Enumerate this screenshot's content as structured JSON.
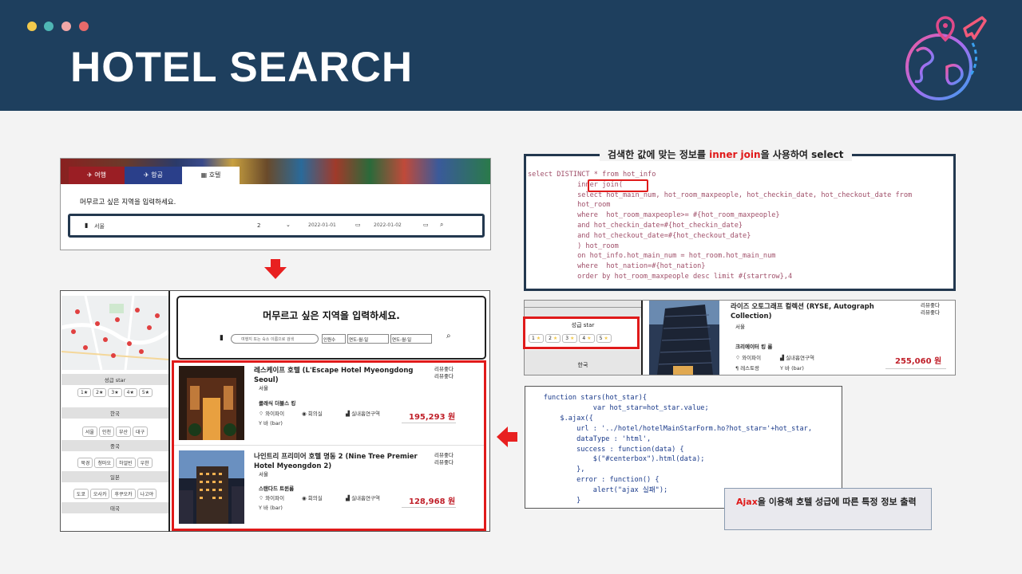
{
  "header": {
    "title": "HOTEL SEARCH",
    "dots": [
      "#f2c94c",
      "#4fb6b4",
      "#f2a7a7",
      "#e86a6a"
    ]
  },
  "search_top": {
    "tabs": [
      "여행",
      "항공",
      "호텔"
    ],
    "prompt": "머무르고 싶은 지역을 입력하세요.",
    "location": "서울",
    "guests": "2",
    "checkin": "2022-01-01",
    "checkout": "2022-01-02"
  },
  "result": {
    "prompt": "머무르고 싶은 지역을 입력하세요.",
    "search_placeholder": "여행지 또는 숙소 이름으로 검색",
    "guests": "인원수",
    "date1": "연도-월-일",
    "date2": "연도-월-일",
    "sidebar": {
      "star_label": "성급 star",
      "stars": [
        "1",
        "2",
        "3",
        "4",
        "5"
      ],
      "korea": "한국",
      "korea_cities": [
        "서울",
        "인천",
        "부산",
        "대구"
      ],
      "china": "중국",
      "china_cities": [
        "북경",
        "청마오",
        "하얼빈",
        "우한"
      ],
      "japan": "일본",
      "japan_cities": [
        "도쿄",
        "오사카",
        "후쿠오카",
        "나고야"
      ],
      "thailand": "태국"
    },
    "hotels": [
      {
        "name": "레스케이프 호텔 (L'Escape Hotel Myeongdong Seoul)",
        "city": "서울",
        "review": "리뷰좋다",
        "review2": "리뷰좋다",
        "room": "클래식 더블스 킹",
        "a1": "와이파이",
        "a2": "회의실",
        "a3": "실내흡연구역",
        "a4": "바 (bar)",
        "price": "195,293 원"
      },
      {
        "name": "나인트리 프리미어 호텔 명동 2 (Nine Tree Premier Hotel Myeongdon 2)",
        "city": "서울",
        "review": "리뷰좋다",
        "review2": "리뷰좋다",
        "room": "스탠다드 트윈룸",
        "a1": "와이파이",
        "a2": "회의실",
        "a3": "실내흡연구역",
        "a4": "바 (bar)",
        "price": "128,968 원"
      }
    ]
  },
  "sql": {
    "caption_pre": "검색한 값에 맞는 정보를 ",
    "caption_hl": "inner join",
    "caption_post": "을 사용하여 select",
    "lines": [
      "select DISTINCT * from hot_info",
      "            inner join(",
      "            select hot_main_num, hot_room_maxpeople, hot_checkin_date, hot_checkout_date from",
      "            hot_room",
      "            where  hot_room_maxpeople>= #{hot_room_maxpeople}",
      "            and hot_checkin_date=#{hot_checkin_date}",
      "            and hot_checkout_date=#{hot_checkout_date}",
      "            ) hot_room",
      "            on hot_info.hot_main_num = hot_room.hot_main_num",
      "            where  hot_nation=#{hot_nation}",
      "            order by hot_room_maxpeople desc limit #{startrow},4"
    ]
  },
  "star_demo": {
    "star_label": "성급 star",
    "stars": [
      "1",
      "2",
      "3",
      "4",
      "5"
    ],
    "country": "한국",
    "name": "라이즈 오토그래프 컬렉션 (RYSE, Autograph Collection)",
    "city": "서울",
    "review": "리뷰좋다",
    "review2": "리뷰좋다",
    "room": "크리에이터 킹 룸",
    "a1": "와이파이",
    "a2": "실내흡연구역",
    "a3": "레스토랑",
    "a4": "바 (bar)",
    "price": "255,060 원"
  },
  "js": {
    "lines": [
      "    function stars(hot_star){",
      "                var hot_star=hot_star.value;",
      "        $.ajax({",
      "            url : '../hotel/hotelMainStarForm.ho?hot_star='+hot_star,",
      "            dataType : 'html',",
      "            success : function(data) {",
      "                $(\"#centerbox\").html(data);",
      "            },",
      "            error : function() {",
      "                alert(\"ajax 실패\");",
      "            }"
    ],
    "caption_hl": "Ajax",
    "caption_rest": "을 이용해 호텔 성급에 따른 특정 정보 출력"
  }
}
